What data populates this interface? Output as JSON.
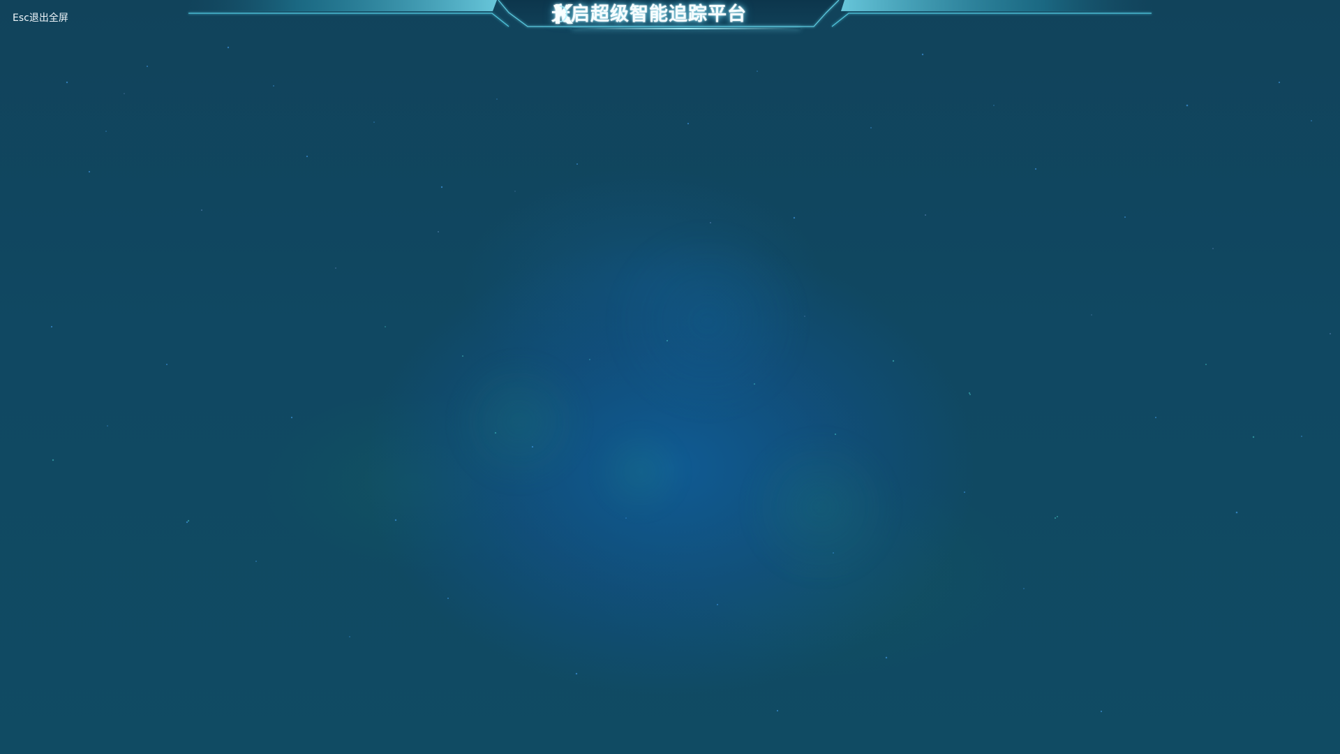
{
  "screen": {
    "exit_fullscreen_text": "Esc退出全屏",
    "title": "光启超级智能追踪平台",
    "colors": {
      "background": "#10435A",
      "nebula_blue": "#1578B8",
      "nebula_green": "#1E9A74",
      "header_cyan": "#68D9F0",
      "title_glow": "#8BEFFF",
      "text": "#F6FDFF"
    },
    "icons": {
      "logo": "brand-k-logo-icon"
    }
  }
}
